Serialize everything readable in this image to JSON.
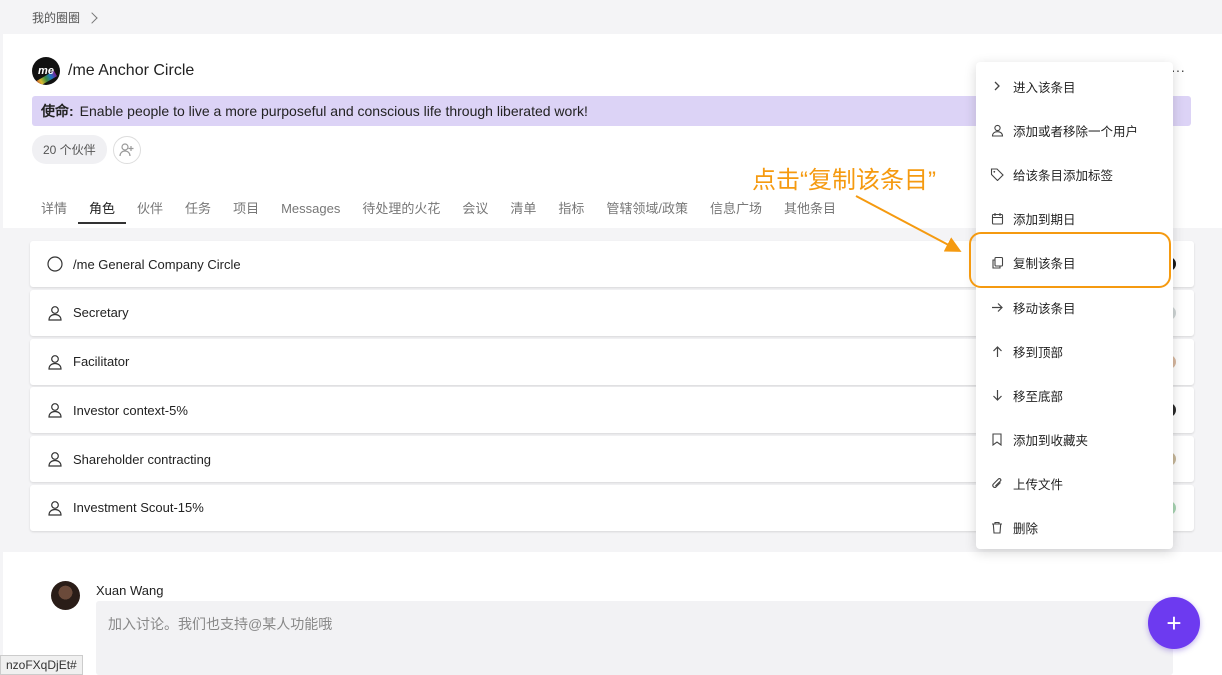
{
  "breadcrumb": {
    "label": "我的圈圈"
  },
  "circle": {
    "title": "/me Anchor Circle",
    "logo_text": "me",
    "mission_label": "使命:",
    "mission_text": "Enable people to live a more purposeful and conscious life through liberated work!",
    "partner_count": "20 个伙伴"
  },
  "tabs": [
    {
      "label": "详情"
    },
    {
      "label": "角色"
    },
    {
      "label": "伙伴"
    },
    {
      "label": "任务"
    },
    {
      "label": "项目"
    },
    {
      "label": "Messages"
    },
    {
      "label": "待处理的火花"
    },
    {
      "label": "会议"
    },
    {
      "label": "清单"
    },
    {
      "label": "指标"
    },
    {
      "label": "管辖领域/政策"
    },
    {
      "label": "信息广场"
    },
    {
      "label": "其他条目"
    }
  ],
  "active_tab": "角色",
  "roles": [
    {
      "label": "/me General Company Circle",
      "icon": "circle-icon",
      "dot_color": "#1a1a1a"
    },
    {
      "label": "Secretary",
      "icon": "person-icon",
      "dot_color": "#cfd6d6"
    },
    {
      "label": "Facilitator",
      "icon": "person-icon",
      "dot_color": "#d8b9a0"
    },
    {
      "label": "Investor context-5%",
      "icon": "person-icon",
      "dot_color": "#2a2a2a"
    },
    {
      "label": "Shareholder contracting",
      "icon": "person-icon",
      "dot_color": "#c8b89a"
    },
    {
      "label": "Investment Scout-15%",
      "icon": "person-icon",
      "dot_color": "#a9d6b4"
    }
  ],
  "menu": {
    "items": [
      {
        "label": "进入该条目",
        "icon": "chevron-right-icon"
      },
      {
        "label": "添加或者移除一个用户",
        "icon": "user-icon"
      },
      {
        "label": "给该条目添加标签",
        "icon": "tag-icon"
      },
      {
        "label": "添加到期日",
        "icon": "calendar-icon"
      },
      {
        "label": "复制该条目",
        "icon": "copy-icon"
      },
      {
        "label": "移动该条目",
        "icon": "arrow-right-icon"
      },
      {
        "label": "移到顶部",
        "icon": "arrow-up-icon"
      },
      {
        "label": "移至底部",
        "icon": "arrow-down-icon"
      },
      {
        "label": "添加到收藏夹",
        "icon": "bookmark-icon"
      },
      {
        "label": "上传文件",
        "icon": "paperclip-icon"
      },
      {
        "label": "删除",
        "icon": "trash-icon"
      }
    ]
  },
  "annotation": {
    "text": "点击“复制该条目”",
    "color": "#f59a10"
  },
  "comment": {
    "author": "Xuan Wang",
    "placeholder": "加入讨论。我们也支持@某人功能哦"
  },
  "fab": {
    "label": "+"
  },
  "status_url": "nzoFXqDjEt#",
  "colors": {
    "accent": "#6d3af0",
    "mission_bg": "#dcd3f6",
    "annotation": "#f59a10"
  }
}
